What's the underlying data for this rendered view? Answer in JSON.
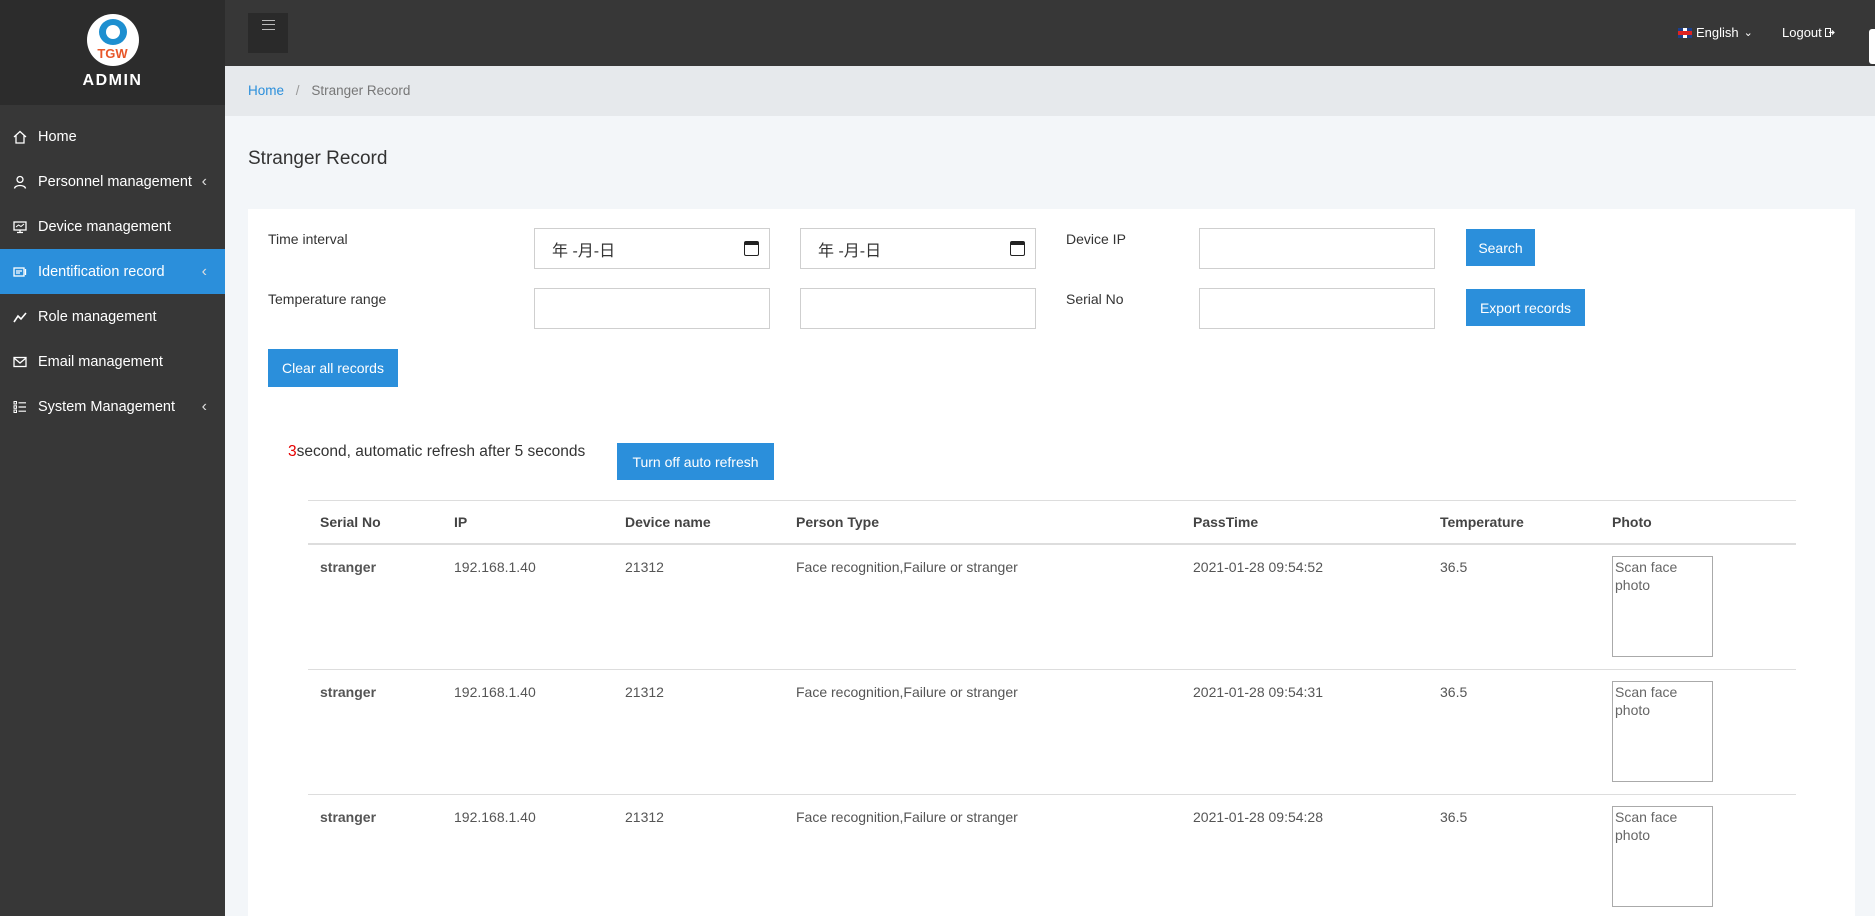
{
  "brand": {
    "logo_text": "TGW",
    "name": "ADMIN"
  },
  "nav": [
    {
      "label": "Home",
      "icon": "home-icon",
      "active": false,
      "has_children": false
    },
    {
      "label": "Personnel management",
      "icon": "user-icon",
      "active": false,
      "has_children": true
    },
    {
      "label": "Device management",
      "icon": "monitor-icon",
      "active": false,
      "has_children": false
    },
    {
      "label": "Identification record",
      "icon": "scan-icon",
      "active": true,
      "has_children": true
    },
    {
      "label": "Role management",
      "icon": "chart-line-icon",
      "active": false,
      "has_children": false
    },
    {
      "label": "Email management",
      "icon": "envelope-icon",
      "active": false,
      "has_children": false
    },
    {
      "label": "System Management",
      "icon": "list-icon",
      "active": false,
      "has_children": true
    }
  ],
  "topbar": {
    "language": "English",
    "logout": "Logout"
  },
  "breadcrumb": {
    "home": "Home",
    "current": "Stranger Record"
  },
  "page_title": "Stranger Record",
  "filters": {
    "time_interval_label": "Time interval",
    "date_start": "年 -月-日",
    "date_end": "年 -月-日",
    "device_ip_label": "Device IP",
    "device_ip_value": "",
    "temperature_label": "Temperature range",
    "temp_min": "",
    "temp_max": "",
    "serial_label": "Serial No",
    "serial_value": "",
    "search_button": "Search",
    "export_button": "Export records",
    "clear_button": "Clear all records"
  },
  "refresh": {
    "count": "3",
    "text": "second, automatic refresh after 5 seconds",
    "toggle_button": "Turn off auto refresh"
  },
  "table": {
    "columns": [
      "Serial No",
      "IP",
      "Device name",
      "Person Type",
      "PassTime",
      "Temperature",
      "Photo"
    ],
    "rows": [
      {
        "serial": "stranger",
        "ip": "192.168.1.40",
        "device": "21312",
        "type": "Face recognition,Failure or stranger",
        "time": "2021-01-28 09:54:52",
        "temp": "36.5",
        "photo_alt": "Scan face photo"
      },
      {
        "serial": "stranger",
        "ip": "192.168.1.40",
        "device": "21312",
        "type": "Face recognition,Failure or stranger",
        "time": "2021-01-28 09:54:31",
        "temp": "36.5",
        "photo_alt": "Scan face photo"
      },
      {
        "serial": "stranger",
        "ip": "192.168.1.40",
        "device": "21312",
        "type": "Face recognition,Failure or stranger",
        "time": "2021-01-28 09:54:28",
        "temp": "36.5",
        "photo_alt": "Scan face photo"
      }
    ]
  },
  "colors": {
    "sidebar": "#373737",
    "accent": "#2b8fdb",
    "count_red": "#e60000"
  }
}
